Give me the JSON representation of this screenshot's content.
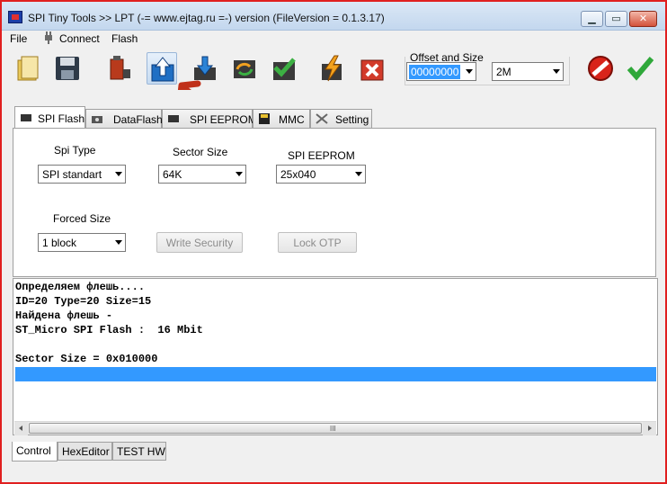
{
  "window": {
    "title": "SPI Tiny Tools >> LPT (-= www.ejtag.ru =-) version (FileVersion = 0.1.3.17)",
    "controls": {
      "minimize": "▁",
      "maximize": "▭",
      "close": "✕"
    }
  },
  "menu": {
    "file": "File",
    "connect": "Connect",
    "flash": "Flash"
  },
  "toolbar": {
    "buttons": [
      {
        "name": "open-folder",
        "icon": "folder-icon"
      },
      {
        "name": "save",
        "icon": "floppy-icon"
      },
      {
        "name": "chip",
        "icon": "chip-battery-icon"
      },
      {
        "name": "read-up",
        "icon": "upload-arrow-icon"
      },
      {
        "name": "write-down",
        "icon": "download-arrow-icon"
      },
      {
        "name": "cycle",
        "icon": "refresh-icon"
      },
      {
        "name": "verify",
        "icon": "checkmark-icon"
      },
      {
        "name": "erase",
        "icon": "lightning-icon"
      },
      {
        "name": "cancel",
        "icon": "red-x-icon"
      }
    ],
    "offset_group_label": "Offset and Size",
    "offset_value": "00000000",
    "size_value": "2M",
    "stop_icon": "stop-icon",
    "ok_icon": "green-check-icon"
  },
  "tabs": {
    "spi_flash": "SPI Flash",
    "dataflash": "DataFlash",
    "spi_eeprom": "SPI EEPROM",
    "mmc": "MMC",
    "setting": "Setting"
  },
  "form": {
    "spi_type_label": "Spi Type",
    "spi_type_value": "SPI standart",
    "sector_size_label": "Sector Size",
    "sector_size_value": "64K",
    "spi_eeprom_label": "SPI EEPROM",
    "spi_eeprom_value": "25x040",
    "forced_size_label": "Forced Size",
    "forced_size_value": "1 block",
    "write_security_label": "Write Security",
    "lock_otp_label": "Lock OTP"
  },
  "log": {
    "lines": [
      "Определяем флешь....",
      "ID=20 Type=20 Size=15",
      "Найдена флешь -",
      "ST_Micro SPI Flash :  16 Mbit",
      "",
      "Sector Size = 0x010000"
    ],
    "scroll_grip": "III"
  },
  "bottom_tabs": {
    "control": "Control",
    "hexeditor": "HexEditor",
    "test_hw": "TEST HW"
  },
  "colors": {
    "accent": "#3399ff",
    "window_border": "#e02020",
    "arrow": "#c0301a"
  }
}
